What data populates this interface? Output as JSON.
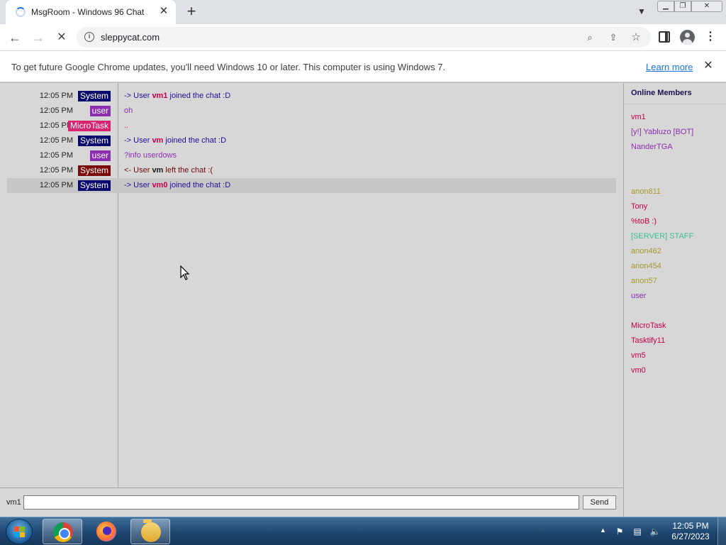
{
  "browser": {
    "tab_title": "MsgRoom - Windows 96 Chat",
    "tab_close": "✕",
    "new_tab": "+",
    "url": "sleppycat.com",
    "infobar_message": "To get future Google Chrome updates, you'll need Windows 10 or later. This computer is using Windows 7.",
    "infobar_link": "Learn more",
    "infobar_close": "✕",
    "icons": [
      "spinner-icon",
      "chevron-down-icon",
      "back-icon",
      "forward-icon",
      "reload-icon",
      "info-icon",
      "search-icon",
      "share-icon",
      "star-icon",
      "side-panel-icon",
      "profile-icon",
      "menu-icon"
    ]
  },
  "chat": {
    "messages": [
      {
        "time": "12:05 PM",
        "sender": "System",
        "badge_color": "#0a0a6e",
        "prefix": "-> User ",
        "user": "vm1",
        "suffix": " joined the chat :D",
        "text_color": "#1f1096",
        "user_color": "#c7004a"
      },
      {
        "time": "12:05 PM",
        "sender": "user",
        "badge_color": "#8a2fb0",
        "prefix": "oh",
        "user": "",
        "suffix": "",
        "text_color": "#8a2fb0",
        "user_color": "#8a2fb0"
      },
      {
        "time": "12:05 PM",
        "sender": "MicroTask",
        "badge_color": "#d6246e",
        "prefix": "..",
        "user": "",
        "suffix": "",
        "text_color": "#d6246e",
        "user_color": "#d6246e"
      },
      {
        "time": "12:05 PM",
        "sender": "System",
        "badge_color": "#0a0a6e",
        "prefix": "-> User ",
        "user": "vm",
        "suffix": " joined the chat :D",
        "text_color": "#1f1096",
        "user_color": "#c7004a"
      },
      {
        "time": "12:05 PM",
        "sender": "user",
        "badge_color": "#8a2fb0",
        "prefix": "?info userdows",
        "user": "",
        "suffix": "",
        "text_color": "#8a2fb0",
        "user_color": "#8a2fb0"
      },
      {
        "time": "12:05 PM",
        "sender": "System",
        "badge_color": "#7a0a0a",
        "prefix": "<- User ",
        "user": "vm",
        "suffix": " left the chat :(",
        "text_color": "#6e0a0a",
        "user_color": "#1a1a1a"
      },
      {
        "time": "12:05 PM",
        "sender": "System",
        "badge_color": "#0a0a6e",
        "prefix": "-> User ",
        "user": "vm0",
        "suffix": " joined the chat :D",
        "text_color": "#1f1096",
        "user_color": "#c7004a"
      }
    ],
    "members_title": "Online Members",
    "members": [
      {
        "name": "vm1",
        "color": "#c7004a"
      },
      {
        "name": "[y!] Yabluzo [BOT]",
        "color": "#8a2fb0"
      },
      {
        "name": "NanderTGA",
        "color": "#8a2fb0"
      },
      {
        "name": "anon811",
        "color": "#a89a2a"
      },
      {
        "name": "Tony",
        "color": "#c7004a"
      },
      {
        "name": "%toB :)",
        "color": "#c7004a"
      },
      {
        "name": "[SERVER] STAFF",
        "color": "#3fbf8f"
      },
      {
        "name": "anon462",
        "color": "#a89a2a"
      },
      {
        "name": "anon454",
        "color": "#a89a2a"
      },
      {
        "name": "anon57",
        "color": "#a89a2a"
      },
      {
        "name": "user",
        "color": "#8a2fb0"
      },
      {
        "name": "MicroTask",
        "color": "#c7004a"
      },
      {
        "name": "Tasktify11",
        "color": "#c7004a"
      },
      {
        "name": "vm5",
        "color": "#c7004a"
      },
      {
        "name": "vm0",
        "color": "#c7004a"
      }
    ],
    "nick": "vm1",
    "input_value": "",
    "send_label": "Send"
  },
  "taskbar": {
    "apps": [
      "chrome-icon",
      "firefox-icon",
      "explorer-icon"
    ],
    "tray_arrow": "▲",
    "time": "12:05 PM",
    "date": "6/27/2023"
  }
}
